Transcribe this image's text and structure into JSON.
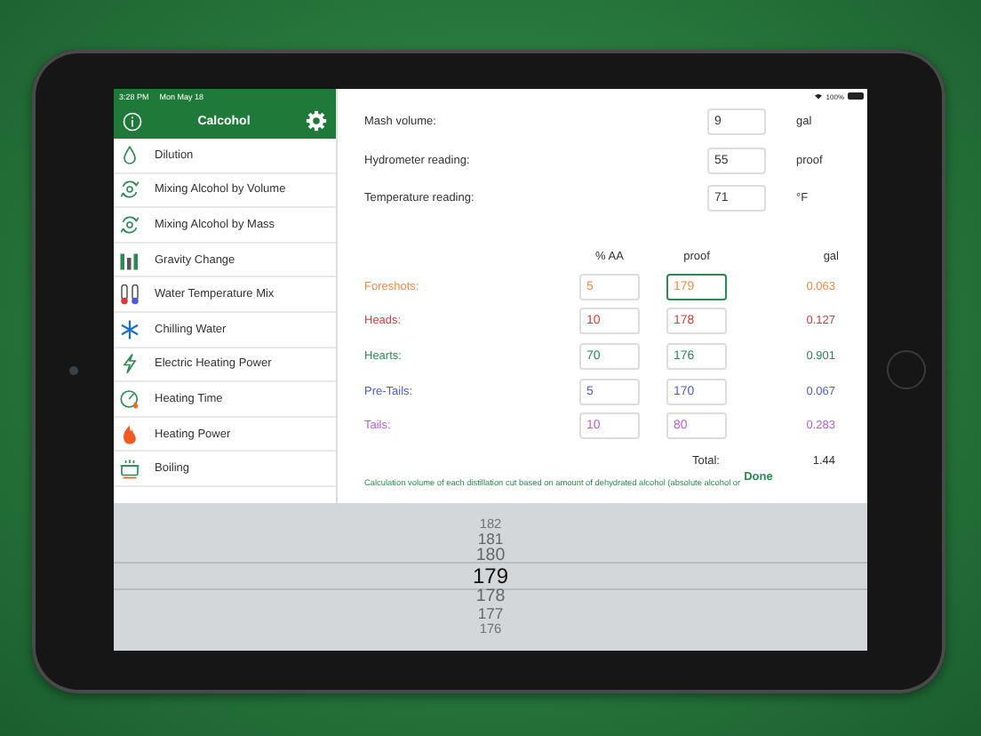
{
  "status_bar": {
    "time": "3:28 PM",
    "date": "Mon May 18",
    "battery": "100%"
  },
  "sidebar": {
    "title": "Calcohol",
    "items": [
      {
        "label": "Dilution"
      },
      {
        "label": "Mixing Alcohol by Volume"
      },
      {
        "label": "Mixing Alcohol by Mass"
      },
      {
        "label": "Gravity Change"
      },
      {
        "label": "Water Temperature Mix"
      },
      {
        "label": "Chilling Water"
      },
      {
        "label": "Electric Heating Power"
      },
      {
        "label": "Heating Time"
      },
      {
        "label": "Heating Power"
      },
      {
        "label": "Boiling"
      }
    ]
  },
  "inputs": [
    {
      "label": "Mash volume:",
      "value": "9",
      "unit": "gal"
    },
    {
      "label": "Hydrometer reading:",
      "value": "55",
      "unit": "proof"
    },
    {
      "label": "Temperature reading:",
      "value": "71",
      "unit": "°F"
    }
  ],
  "cuts": {
    "columns": [
      "% AA",
      "proof",
      "gal"
    ],
    "rows": [
      {
        "name": "Foreshots:",
        "color": "#f08a45",
        "aa": "5",
        "proof": "179",
        "gal": "0.063",
        "selected": true
      },
      {
        "name": "Heads:",
        "color": "#d93a3a",
        "aa": "10",
        "proof": "178",
        "gal": "0.127",
        "selected": false
      },
      {
        "name": "Hearts:",
        "color": "#2a8a52",
        "aa": "70",
        "proof": "176",
        "gal": "0.901",
        "selected": false
      },
      {
        "name": "Pre-Tails:",
        "color": "#4a5ad8",
        "aa": "5",
        "proof": "170",
        "gal": "0.067",
        "selected": false
      },
      {
        "name": "Tails:",
        "color": "#b45ee0",
        "aa": "10",
        "proof": "80",
        "gal": "0.283",
        "selected": false
      }
    ],
    "total_label": "Total:",
    "total": "1.44"
  },
  "description": "Calculation volume of each distillation cut based on amount of dehydrated alcohol (absolute alcohol or",
  "done_button": "Done",
  "picker": [
    {
      "value": "182",
      "selected": false
    },
    {
      "value": "181",
      "selected": false
    },
    {
      "value": "180",
      "selected": false
    },
    {
      "value": "179",
      "selected": true
    },
    {
      "value": "178",
      "selected": false
    },
    {
      "value": "177",
      "selected": false
    },
    {
      "value": "176",
      "selected": false
    }
  ]
}
